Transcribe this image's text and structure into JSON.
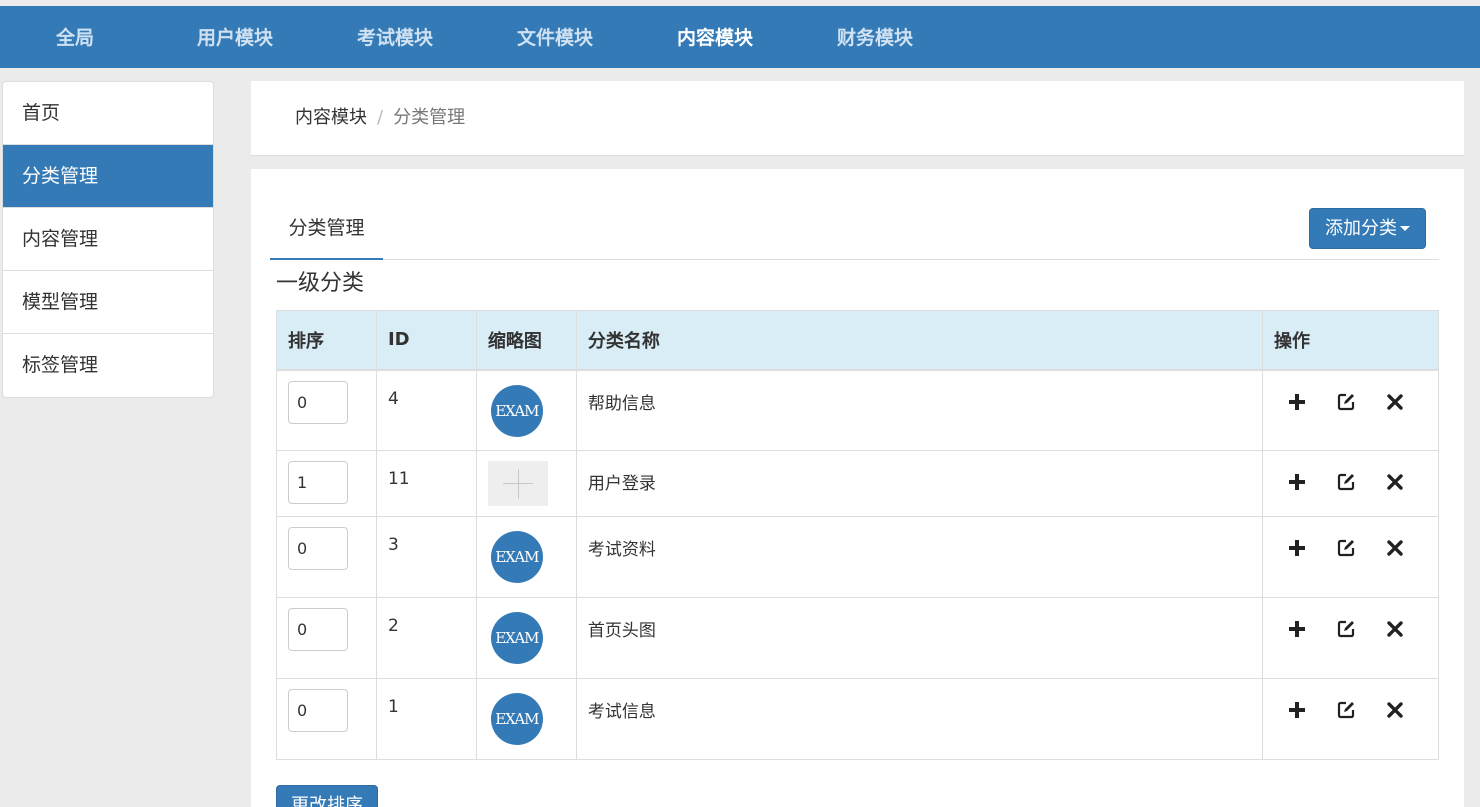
{
  "top_nav": {
    "items": [
      {
        "label": "全局"
      },
      {
        "label": "用户模块"
      },
      {
        "label": "考试模块"
      },
      {
        "label": "文件模块"
      },
      {
        "label": "内容模块",
        "active": true
      },
      {
        "label": "财务模块"
      }
    ]
  },
  "sidebar": {
    "items": [
      {
        "label": "首页"
      },
      {
        "label": "分类管理",
        "active": true
      },
      {
        "label": "内容管理"
      },
      {
        "label": "模型管理"
      },
      {
        "label": "标签管理"
      }
    ]
  },
  "breadcrumb": {
    "parent": "内容模块",
    "separator": "/",
    "current": "分类管理"
  },
  "main": {
    "tab_label": "分类管理",
    "add_button_label": "添加分类",
    "section_title": "一级分类",
    "resort_button_label": "更改排序"
  },
  "table": {
    "headers": [
      "排序",
      "ID",
      "缩略图",
      "分类名称",
      "操作"
    ],
    "rows": [
      {
        "sort": "0",
        "id": "4",
        "thumb_text": "EXAM",
        "name": "帮助信息"
      },
      {
        "sort": "1",
        "id": "11",
        "thumb_text": "",
        "name": "用户登录"
      },
      {
        "sort": "0",
        "id": "3",
        "thumb_text": "EXAM",
        "name": "考试资料"
      },
      {
        "sort": "0",
        "id": "2",
        "thumb_text": "EXAM",
        "name": "首页头图"
      },
      {
        "sort": "0",
        "id": "1",
        "thumb_text": "EXAM",
        "name": "考试信息"
      }
    ]
  },
  "icons": {
    "add": "plus-icon",
    "edit": "edit-icon",
    "delete": "close-icon"
  },
  "colors": {
    "primary": "#337ab7",
    "table_header_bg": "#d9edf7",
    "page_bg": "#ebebeb"
  }
}
